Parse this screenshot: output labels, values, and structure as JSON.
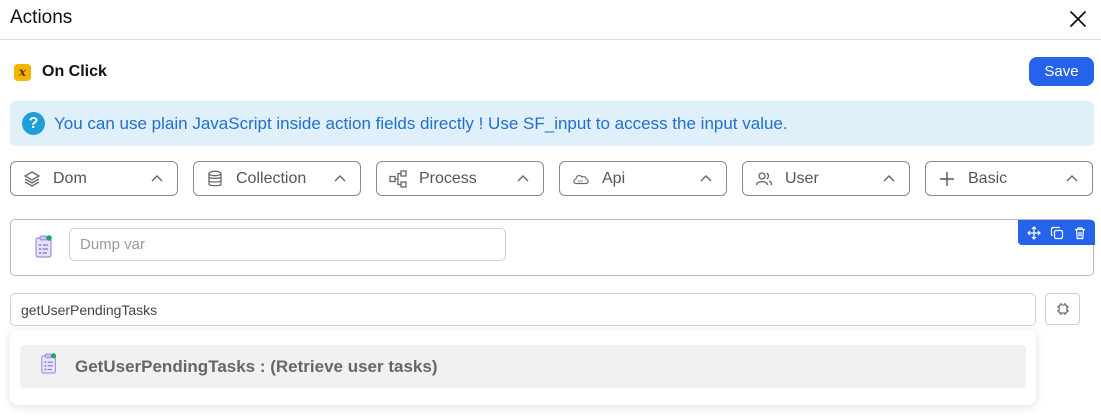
{
  "header": {
    "title": "Actions"
  },
  "event": {
    "label": "On Click",
    "icon": "variable-icon",
    "icon_glyph": "x"
  },
  "toolbar": {
    "save_label": "Save"
  },
  "info": {
    "icon_glyph": "?",
    "text": "You can use plain JavaScript inside action fields directly ! Use SF_input to access the input value."
  },
  "categories": [
    {
      "label": "Dom",
      "icon": "layers-icon"
    },
    {
      "label": "Collection",
      "icon": "database-icon"
    },
    {
      "label": "Process",
      "icon": "flow-icon"
    },
    {
      "label": "Api",
      "icon": "cloud-api-icon"
    },
    {
      "label": "User",
      "icon": "users-icon"
    },
    {
      "label": "Basic",
      "icon": "plus-icon"
    }
  ],
  "action": {
    "placeholder": "Dump var",
    "value": ""
  },
  "search": {
    "value": "getUserPendingTasks"
  },
  "dropdown": {
    "items": [
      {
        "label": "GetUserPendingTasks : (Retrieve user tasks)"
      }
    ]
  },
  "colors": {
    "accent": "#2563eb",
    "info_bg": "#dff0fb",
    "info_text": "#1f6fd1",
    "event_icon": "#f4b400"
  }
}
